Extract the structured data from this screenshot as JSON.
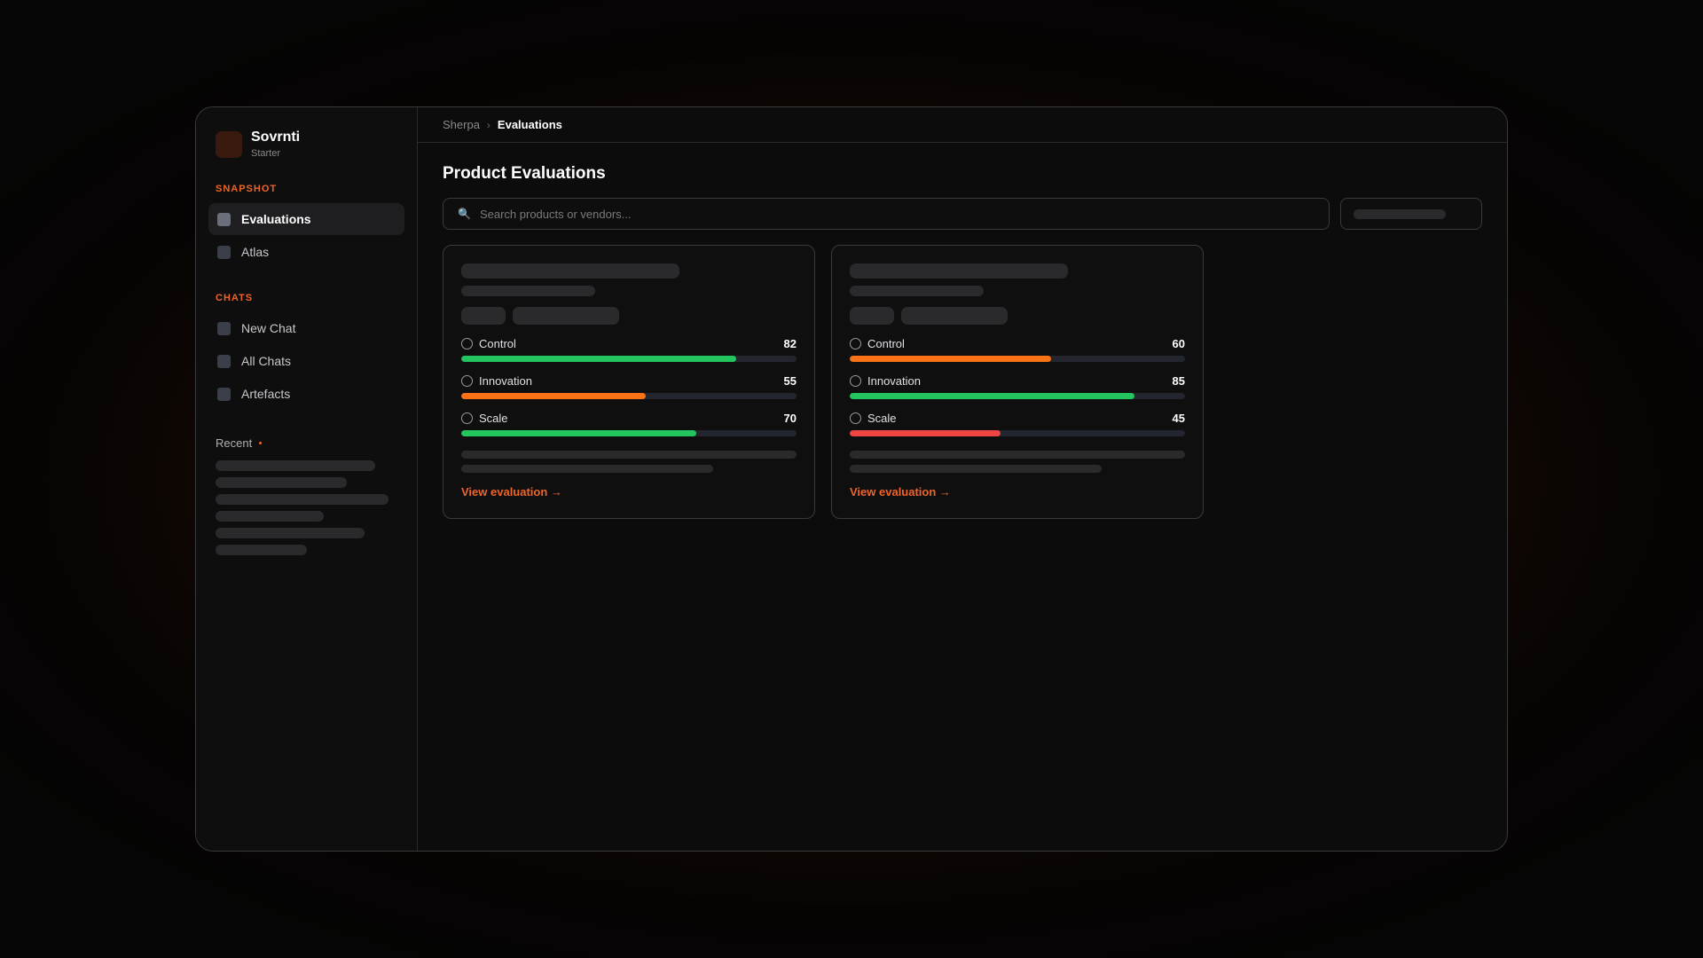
{
  "brand": {
    "name": "Sovrnti",
    "plan": "Starter"
  },
  "sidebar": {
    "sections": [
      {
        "label": "SNAPSHOT",
        "items": [
          {
            "label": "Evaluations",
            "active": true
          },
          {
            "label": "Atlas",
            "active": false
          }
        ]
      },
      {
        "label": "CHATS",
        "items": [
          {
            "label": "New Chat"
          },
          {
            "label": "All Chats"
          },
          {
            "label": "Artefacts"
          }
        ]
      }
    ],
    "recent_label": "Recent"
  },
  "breadcrumb": {
    "root": "Sherpa",
    "separator": "›",
    "current": "Evaluations"
  },
  "page": {
    "title": "Product Evaluations"
  },
  "search": {
    "placeholder": "Search products or vendors..."
  },
  "colors": {
    "accent": "#f0642a",
    "good": "#22c55e",
    "mid": "#f97316",
    "low": "#ef4444"
  },
  "cards": [
    {
      "metrics": [
        {
          "label": "Control",
          "score": 82,
          "color": "#22c55e"
        },
        {
          "label": "Innovation",
          "score": 55,
          "color": "#f97316"
        },
        {
          "label": "Scale",
          "score": 70,
          "color": "#22c55e"
        }
      ],
      "link": "View evaluation →"
    },
    {
      "metrics": [
        {
          "label": "Control",
          "score": 60,
          "color": "#f97316"
        },
        {
          "label": "Innovation",
          "score": 85,
          "color": "#22c55e"
        },
        {
          "label": "Scale",
          "score": 45,
          "color": "#ef4444"
        }
      ],
      "link": "View evaluation →"
    }
  ]
}
